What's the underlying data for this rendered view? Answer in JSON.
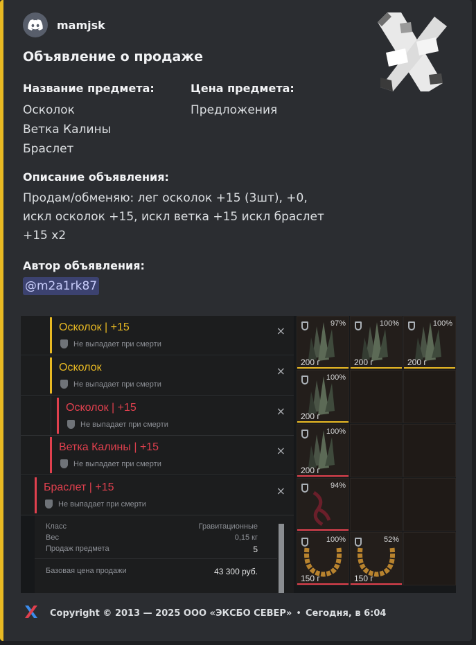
{
  "author": {
    "name": "mamjsk",
    "avatar_icon": "discord-icon"
  },
  "title": "Объявление о продаже",
  "fields": {
    "item_name": {
      "name": "Название предмета:",
      "values": [
        "Осколок",
        "Ветка Калины",
        "Браслет"
      ]
    },
    "item_price": {
      "name": "Цена предмета:",
      "value": "Предложения"
    },
    "description": {
      "name": "Описание объявления:",
      "lines": [
        "Продам/обменяю: лег осколок +15 (3шт), +0,",
        "искл осколок +15, искл ветка +15 искл браслет",
        "+15 x2"
      ]
    },
    "author": {
      "name": "Автор объявления:",
      "mention": "@m2a1rk87"
    }
  },
  "screenshot": {
    "items": [
      {
        "name": "Осколок | +15",
        "note": "Не выпадает при смерти",
        "color": "#e8b923"
      },
      {
        "name": "Осколок",
        "note": "Не выпадает при смерти",
        "color": "#e8b923"
      },
      {
        "name": "Осколок | +15",
        "note": "Не выпадает при смерти",
        "color": "#e0404e"
      },
      {
        "name": "Ветка Калины | +15",
        "note": "Не выпадает при смерти",
        "color": "#e0404e"
      },
      {
        "name": "Браслет | +15",
        "note": "Не выпадает при смерти",
        "color": "#e0404e"
      }
    ],
    "close_glyph": "×",
    "details": [
      {
        "label": "Класс",
        "value": "Гравитационные"
      },
      {
        "label": "Вес",
        "value": "0,15 кг"
      },
      {
        "label": "Продаж предмета",
        "value": "5"
      },
      {
        "label": "Базовая цена продажи",
        "value": "43 300 руб."
      }
    ],
    "inventory": [
      {
        "pct": "97%",
        "price": "200 г",
        "kind": "crystal",
        "rarity": "#e8b923"
      },
      {
        "pct": "100%",
        "price": "200 г",
        "kind": "crystal",
        "rarity": "#e8b923"
      },
      {
        "pct": "100%",
        "price": "200 г",
        "kind": "crystal",
        "rarity": "#e8b923"
      },
      {
        "pct": "100%",
        "price": "200 г",
        "kind": "crystal",
        "rarity": "#e8b923"
      },
      {
        "pct": "100%",
        "price": "200 г",
        "kind": "crystal",
        "rarity": "#e0404e"
      },
      {
        "pct": "94%",
        "price": "",
        "kind": "branch",
        "rarity": "#e0404e"
      },
      {
        "pct": "100%",
        "price": "150 г",
        "kind": "bracelet",
        "rarity": "#e0404e"
      },
      {
        "pct": "52%",
        "price": "150 г",
        "kind": "bracelet",
        "rarity": "#e0404e"
      }
    ]
  },
  "footer": {
    "icon": "exbo-logo-icon",
    "text": "Copyright © 2013 — 2025 ООО «ЭКСБО СЕВЕР»",
    "timestamp": "Сегодня, в 6:04"
  },
  "colors": {
    "accent": "#e8b923",
    "background": "#2b2d31",
    "mention_bg": "#3c4270"
  }
}
